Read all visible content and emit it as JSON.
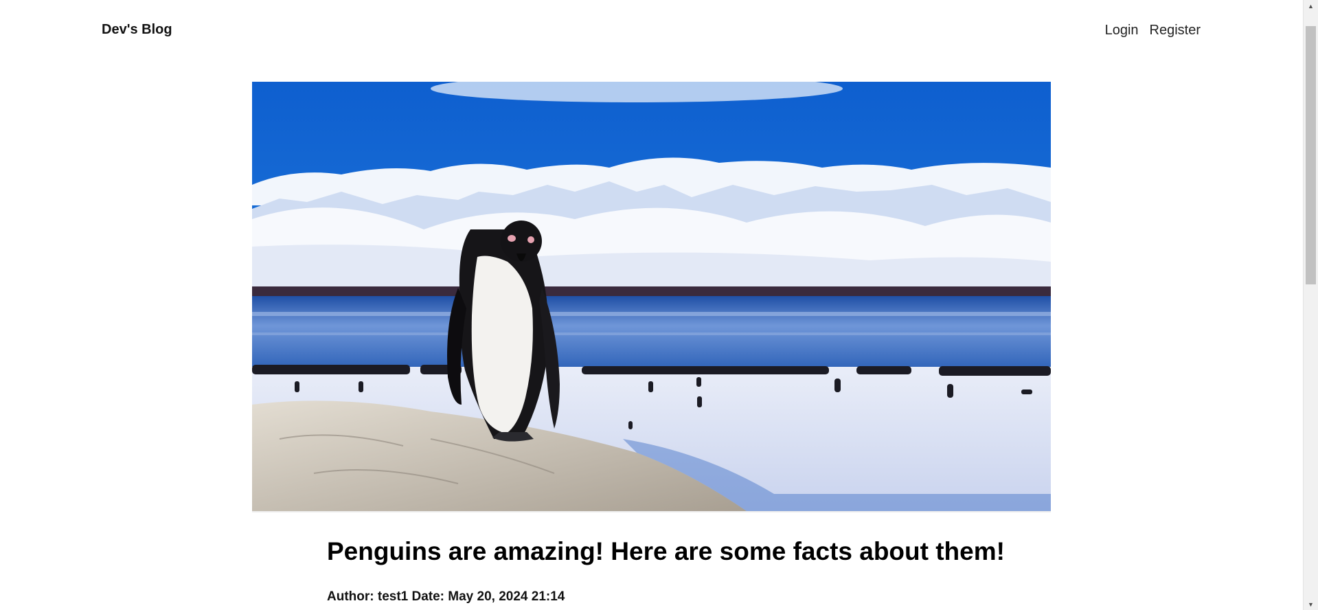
{
  "navbar": {
    "brand": "Dev's Blog",
    "links": {
      "login": "Login",
      "register": "Register"
    }
  },
  "post": {
    "image_alt": "Penguin standing on a rock in front of snowy mountains and a colony of penguins",
    "title": "Penguins are amazing! Here are some facts about them!",
    "meta": "Author: test1 Date: May 20, 2024 21:14"
  },
  "scrollbar": {
    "up_icon": "triangle-up",
    "down_icon": "triangle-down"
  },
  "colors": {
    "sky": "#1a6fd6",
    "ice": "#eef3fb",
    "water": "#3d74c9",
    "text": "#111111"
  }
}
